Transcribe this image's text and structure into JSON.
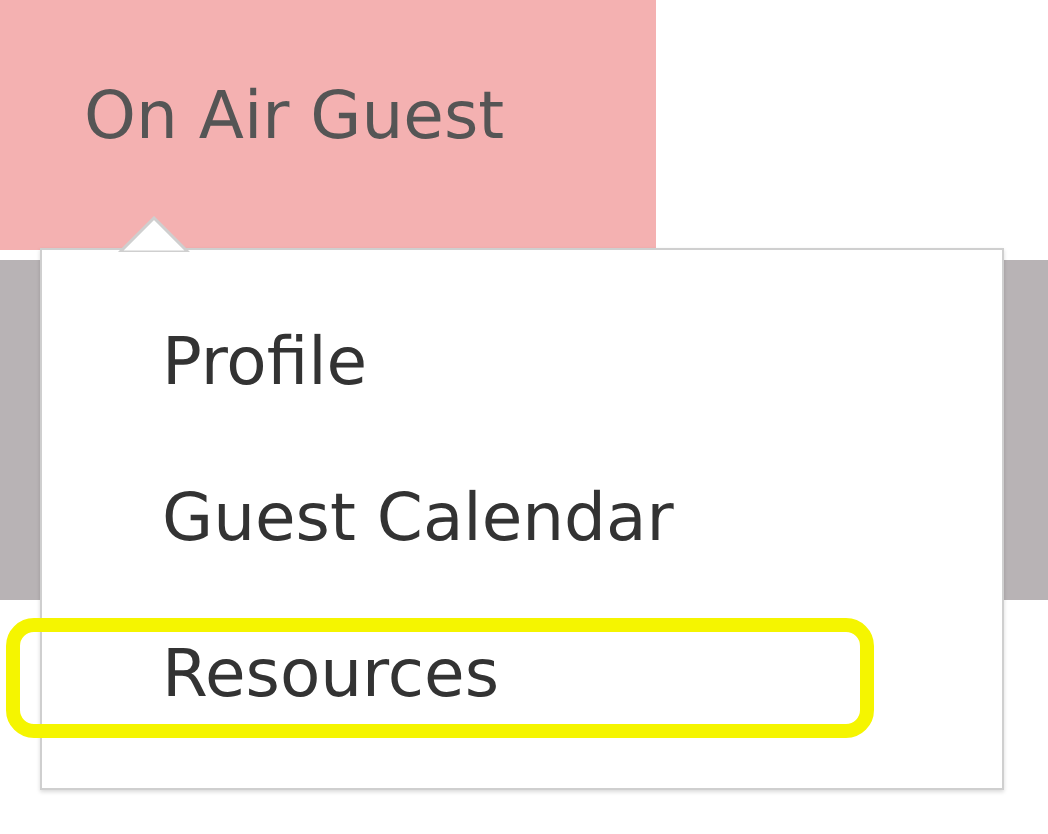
{
  "nav_tab": {
    "label": "On Air Guest",
    "selected": true
  },
  "menu": {
    "items": [
      {
        "label": "Profile",
        "highlighted": false
      },
      {
        "label": "Guest Calendar",
        "highlighted": false
      },
      {
        "label": "Resources",
        "highlighted": true
      }
    ]
  }
}
